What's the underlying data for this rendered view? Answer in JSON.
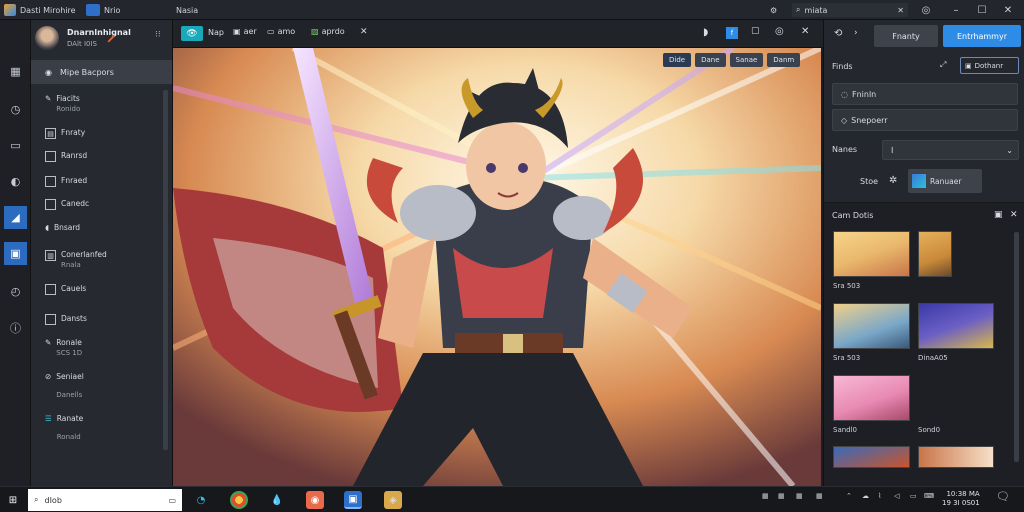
{
  "titlebar": {
    "app_name": "Dasti Mirohire",
    "tab1": "Nrio",
    "tab2": "Nasia",
    "search_text": "miata"
  },
  "user": {
    "name": "Dnarnlnhignal",
    "subtitle": "DAlt I0IS"
  },
  "layers": {
    "header": "Mipe Bacpors",
    "items": [
      {
        "label": "Fiacits",
        "sub": "Ronido"
      },
      {
        "label": "Fnraty",
        "sub": ""
      },
      {
        "label": "Ranrsd",
        "sub": ""
      },
      {
        "label": "Fnraed",
        "sub": ""
      },
      {
        "label": "Canedc",
        "sub": ""
      },
      {
        "label": "Bnsard",
        "sub": ""
      },
      {
        "label": "Conerlanfed",
        "sub": "Rnala"
      },
      {
        "label": "Cauels",
        "sub": ""
      },
      {
        "label": "Dansts",
        "sub": ""
      },
      {
        "label": "Ronale",
        "sub": "SCS 1D"
      },
      {
        "label": "Seniael",
        "sub": "Danells"
      },
      {
        "label": "Ranate",
        "sub": "Ronald"
      }
    ]
  },
  "canvas_toolbar": {
    "tool1": "Nap",
    "tool2": "aer",
    "tool3": "amo",
    "tool4": "aprdo",
    "chips": [
      "Dide",
      "Dane",
      "Sanae",
      "Danm"
    ]
  },
  "right": {
    "btn_secondary": "Fnanty",
    "btn_primary": "Entrhammyr",
    "section_label": "Finds",
    "section_btn": "Dothanr",
    "option1": "Fninln",
    "option2": "Snepoerr",
    "name_label": "Nanes",
    "name_value": "I",
    "size_label": "Stoe",
    "size_chip": "Ranuaer",
    "gallery_title": "Cam Dotis",
    "thumbs": [
      {
        "label": "",
        "color": "#e9b86c"
      },
      {
        "label": "",
        "color": "#c98a3a"
      },
      {
        "label": "Sra 503",
        "color": "#7aa7c9"
      },
      {
        "label": "DinaA05",
        "color": "#6b5fc4"
      },
      {
        "label": "Sandl0",
        "color": "#e88ab4"
      },
      {
        "label": "Sond0",
        "color": "#2a2d33"
      },
      {
        "label": "",
        "color": "#c9552d"
      },
      {
        "label": "",
        "color": "#e6a06a"
      }
    ]
  },
  "taskbar": {
    "search_text": "dIob",
    "clock_time": "10:38 MA",
    "clock_date": "19 3I 0S01"
  },
  "colors": {
    "accent": "#2e8be6",
    "teal": "#19a9b8"
  }
}
